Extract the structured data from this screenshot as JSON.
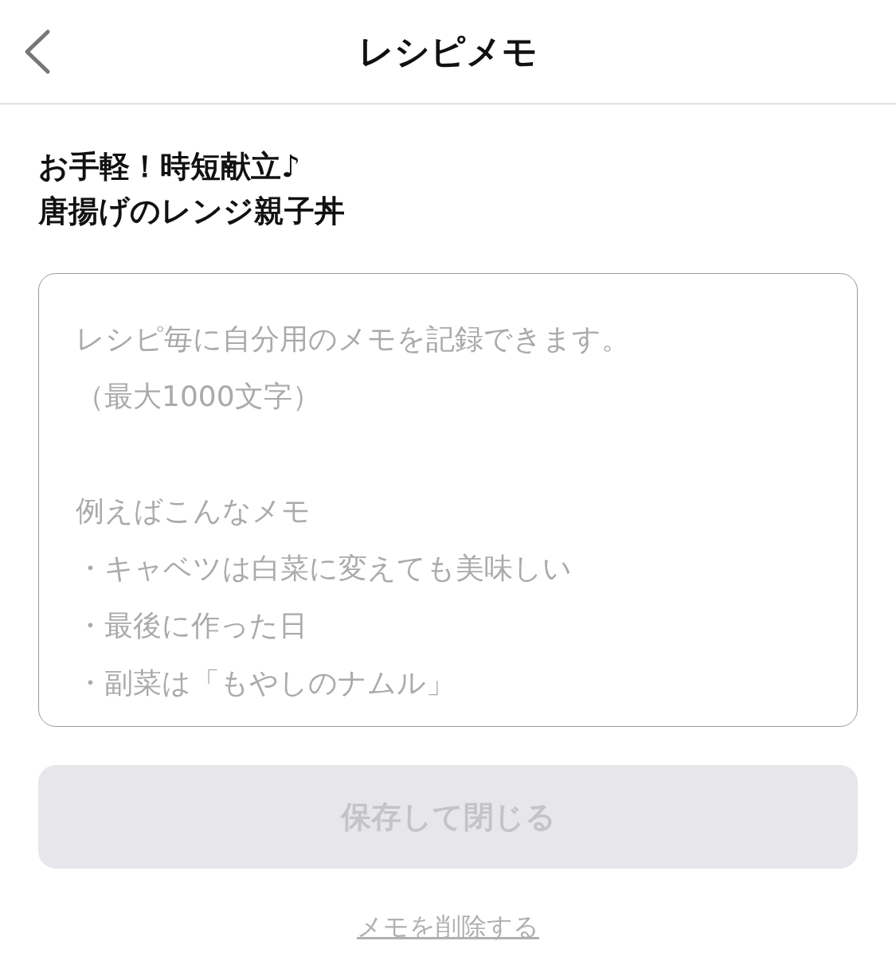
{
  "header": {
    "title": "レシピメモ"
  },
  "recipe_title": "お手軽！時短献立♪\n唐揚げのレンジ親子丼",
  "memo_field": {
    "placeholder_paragraphs": [
      [
        "レシピ毎に自分用のメモを記録できます。",
        "（最大1000文字）"
      ],
      [
        "例えばこんなメモ",
        "・キャベツは白菜に変えても美味しい",
        "・最後に作った日",
        "・副菜は「もやしのナムル」"
      ]
    ]
  },
  "save_button": {
    "label": "保存して閉じる",
    "disabled": true
  },
  "delete_link": {
    "label": "メモを削除する"
  }
}
